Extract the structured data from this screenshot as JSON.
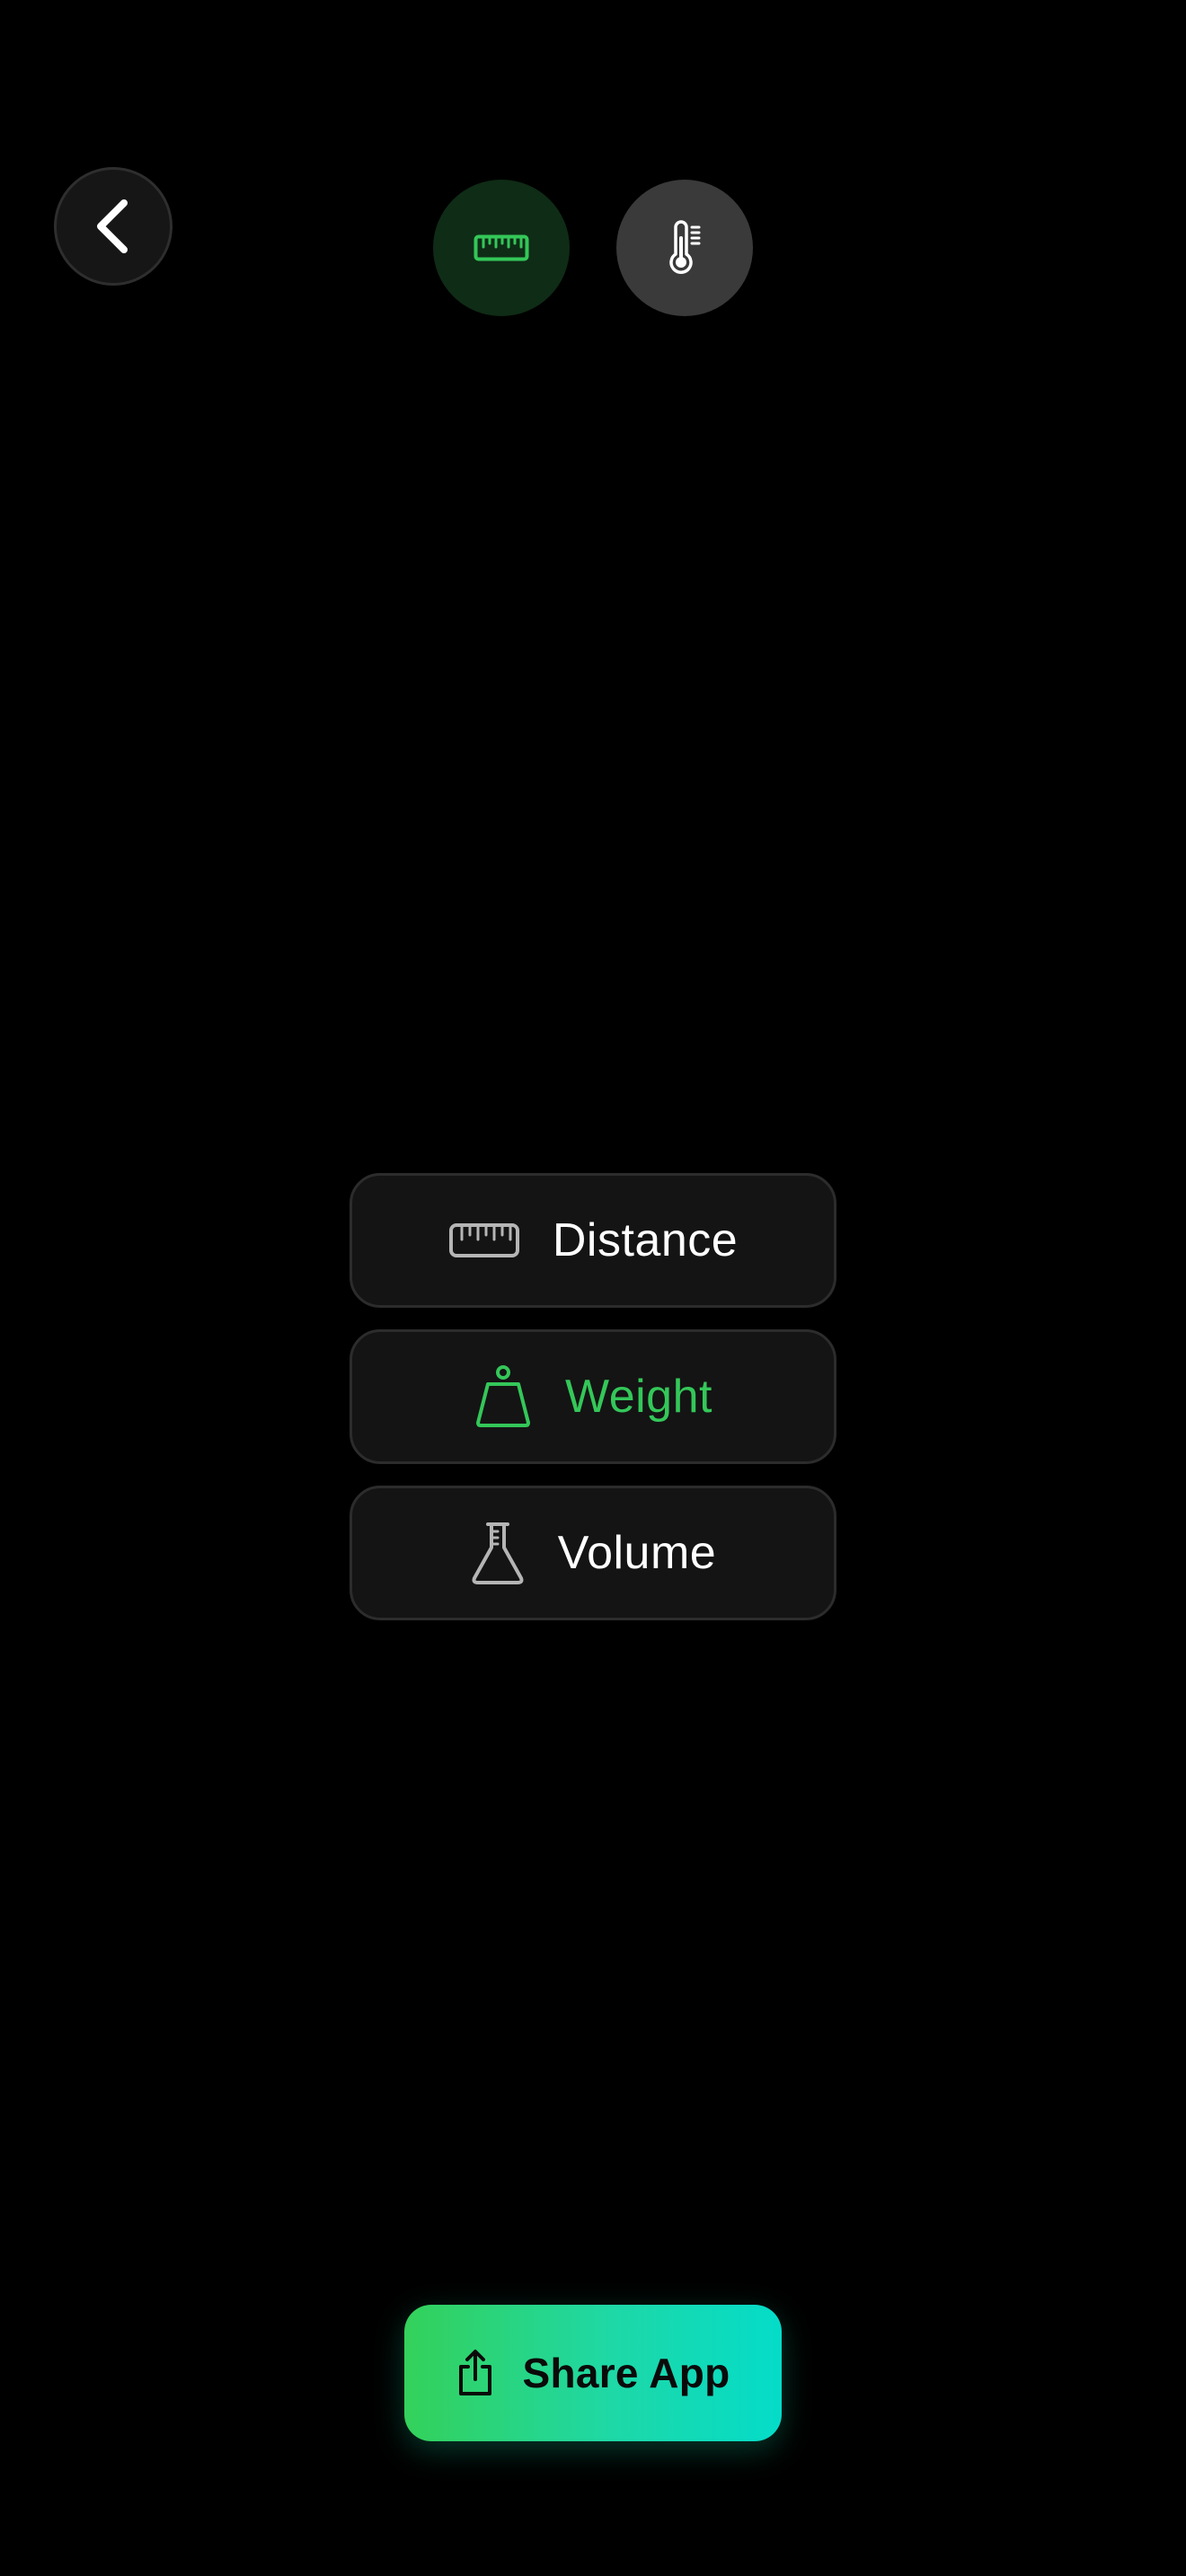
{
  "navigation": {
    "back_icon": "chevron-left-icon"
  },
  "mode_toggle": {
    "items": [
      {
        "id": "measure",
        "icon": "ruler-icon",
        "selected": true,
        "color": "#34c759"
      },
      {
        "id": "temperature",
        "icon": "thermometer-icon",
        "selected": false,
        "color": "#ffffff"
      }
    ]
  },
  "categories": {
    "items": [
      {
        "label": "Distance",
        "icon": "ruler-icon",
        "selected": false
      },
      {
        "label": "Weight",
        "icon": "weight-icon",
        "selected": true
      },
      {
        "label": "Volume",
        "icon": "flask-icon",
        "selected": false
      }
    ]
  },
  "share": {
    "label": "Share App",
    "icon": "share-icon"
  },
  "colors": {
    "background": "#000000",
    "accent_green": "#34c759",
    "share_gradient_start": "#34d15a",
    "share_gradient_end": "#04dcc9"
  }
}
